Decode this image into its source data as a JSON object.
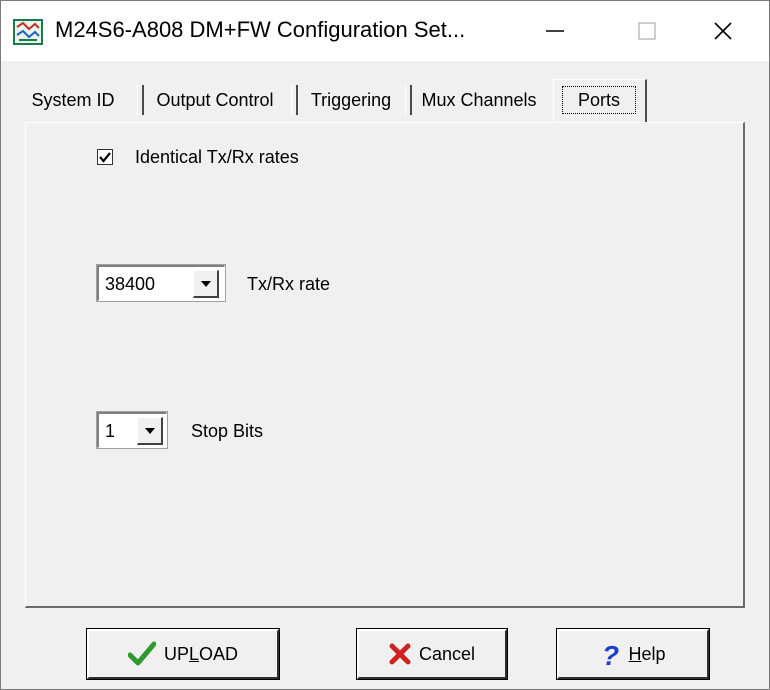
{
  "window": {
    "title": "M24S6-A808 DM+FW Configuration Set...",
    "icon": "app-config-icon",
    "controls": {
      "minimize": "—",
      "maximize": "☐",
      "close": "✕"
    }
  },
  "tabs": [
    {
      "label": "System ID",
      "active": false
    },
    {
      "label": "Output Control",
      "active": false
    },
    {
      "label": "Triggering",
      "active": false
    },
    {
      "label": "Mux Channels",
      "active": false
    },
    {
      "label": "Ports",
      "active": true
    }
  ],
  "ports": {
    "identical_rates": {
      "label": "Identical Tx/Rx rates",
      "checked": true
    },
    "rate": {
      "value": "38400",
      "label": "Tx/Rx rate"
    },
    "stop_bits": {
      "value": "1",
      "label": "Stop Bits"
    }
  },
  "buttons": {
    "upload": {
      "pre": "UP",
      "mnemonic": "L",
      "post": "OAD",
      "icon": "checkmark-icon"
    },
    "cancel": {
      "label": "Cancel",
      "icon": "red-x-icon"
    },
    "help": {
      "mnemonic": "H",
      "post": "elp",
      "icon": "question-mark-icon"
    }
  },
  "colors": {
    "check_green": "#2e9a2e",
    "cancel_red": "#d02020",
    "help_blue": "#1a3fd0"
  }
}
